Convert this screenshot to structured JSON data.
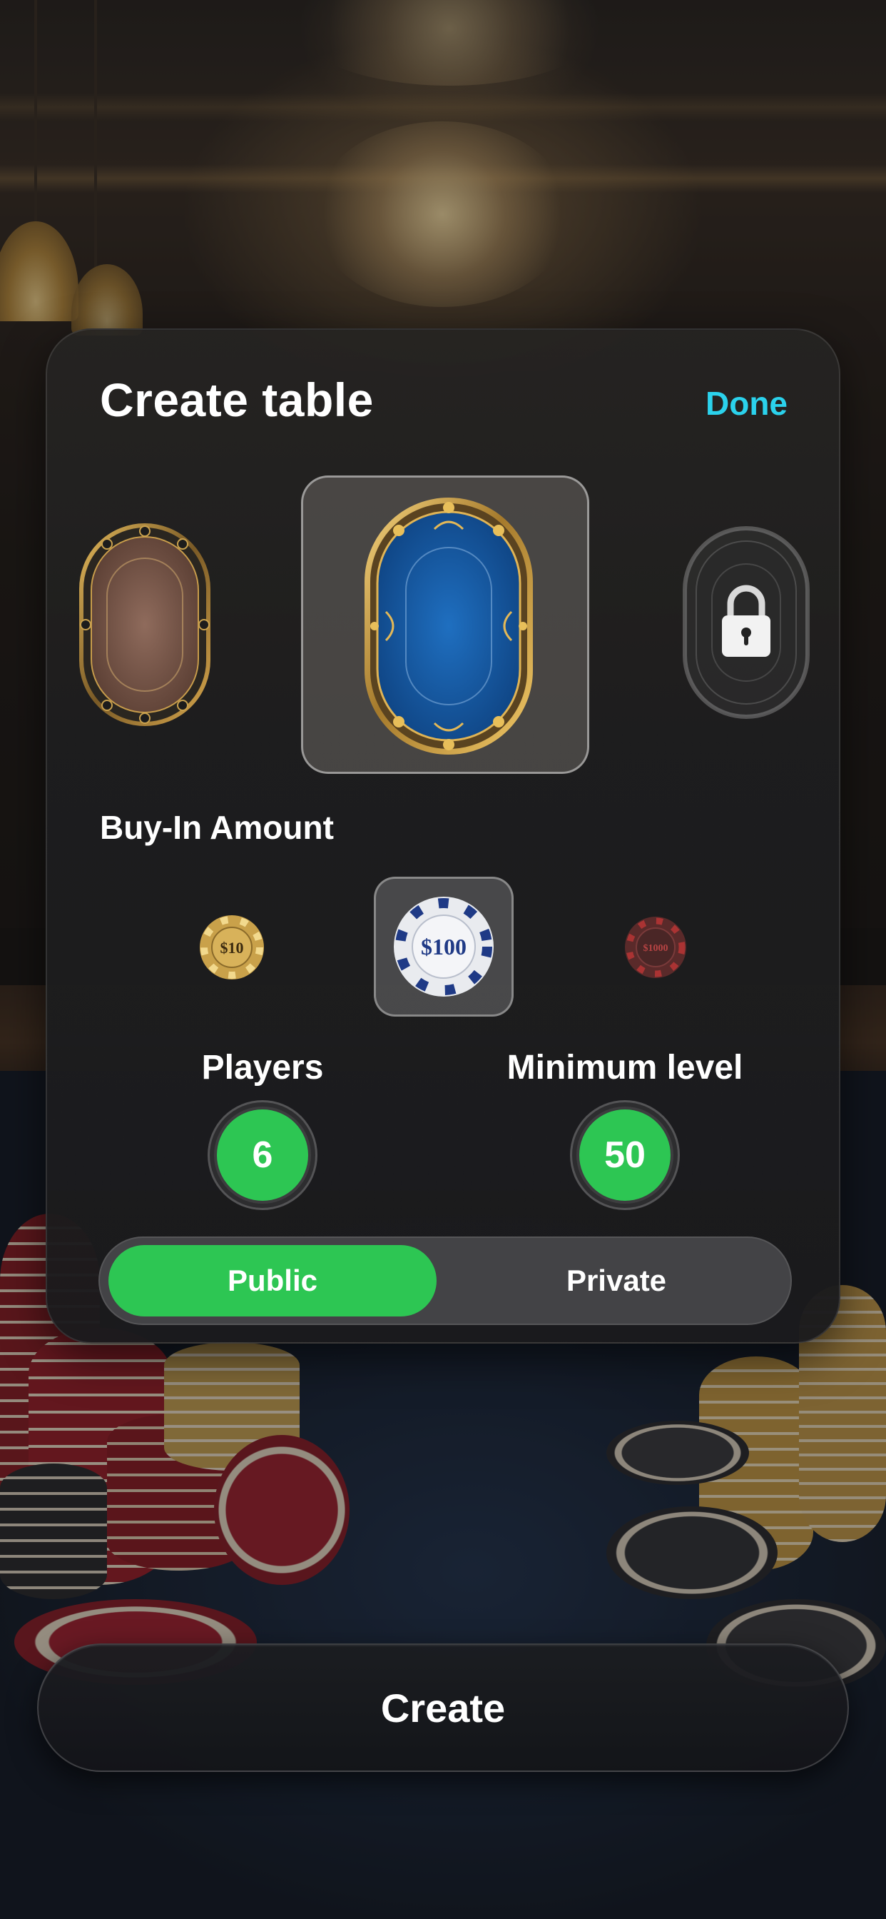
{
  "title": "Create table",
  "done_label": "Done",
  "tables": [
    {
      "name": "wooden-table",
      "state": "available"
    },
    {
      "name": "blue-table",
      "state": "selected"
    },
    {
      "name": "silver-table",
      "state": "locked"
    }
  ],
  "buy_in": {
    "label": "Buy-In Amount",
    "options": [
      {
        "value": "$10",
        "state": "available"
      },
      {
        "value": "$100",
        "state": "selected"
      },
      {
        "value": "$1000",
        "state": "available"
      }
    ]
  },
  "players": {
    "label": "Players",
    "value": "6"
  },
  "min_level": {
    "label": "Minimum level",
    "value": "50"
  },
  "visibility": {
    "options": [
      "Public",
      "Private"
    ],
    "selected": "Public"
  },
  "create_label": "Create",
  "colors": {
    "accent": "#2bd2ec",
    "green": "#2dc653",
    "card": "#1e1e1f"
  }
}
